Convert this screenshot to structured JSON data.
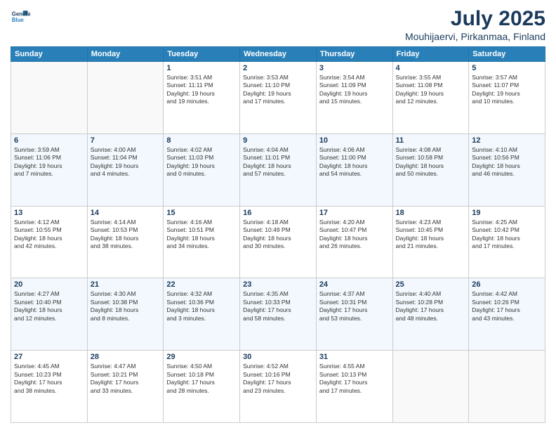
{
  "header": {
    "logo_line1": "General",
    "logo_line2": "Blue",
    "title": "July 2025",
    "subtitle": "Mouhijaervi, Pirkanmaa, Finland"
  },
  "weekdays": [
    "Sunday",
    "Monday",
    "Tuesday",
    "Wednesday",
    "Thursday",
    "Friday",
    "Saturday"
  ],
  "weeks": [
    [
      {
        "day": "",
        "info": ""
      },
      {
        "day": "",
        "info": ""
      },
      {
        "day": "1",
        "info": "Sunrise: 3:51 AM\nSunset: 11:11 PM\nDaylight: 19 hours\nand 19 minutes."
      },
      {
        "day": "2",
        "info": "Sunrise: 3:53 AM\nSunset: 11:10 PM\nDaylight: 19 hours\nand 17 minutes."
      },
      {
        "day": "3",
        "info": "Sunrise: 3:54 AM\nSunset: 11:09 PM\nDaylight: 19 hours\nand 15 minutes."
      },
      {
        "day": "4",
        "info": "Sunrise: 3:55 AM\nSunset: 11:08 PM\nDaylight: 19 hours\nand 12 minutes."
      },
      {
        "day": "5",
        "info": "Sunrise: 3:57 AM\nSunset: 11:07 PM\nDaylight: 19 hours\nand 10 minutes."
      }
    ],
    [
      {
        "day": "6",
        "info": "Sunrise: 3:59 AM\nSunset: 11:06 PM\nDaylight: 19 hours\nand 7 minutes."
      },
      {
        "day": "7",
        "info": "Sunrise: 4:00 AM\nSunset: 11:04 PM\nDaylight: 19 hours\nand 4 minutes."
      },
      {
        "day": "8",
        "info": "Sunrise: 4:02 AM\nSunset: 11:03 PM\nDaylight: 19 hours\nand 0 minutes."
      },
      {
        "day": "9",
        "info": "Sunrise: 4:04 AM\nSunset: 11:01 PM\nDaylight: 18 hours\nand 57 minutes."
      },
      {
        "day": "10",
        "info": "Sunrise: 4:06 AM\nSunset: 11:00 PM\nDaylight: 18 hours\nand 54 minutes."
      },
      {
        "day": "11",
        "info": "Sunrise: 4:08 AM\nSunset: 10:58 PM\nDaylight: 18 hours\nand 50 minutes."
      },
      {
        "day": "12",
        "info": "Sunrise: 4:10 AM\nSunset: 10:56 PM\nDaylight: 18 hours\nand 46 minutes."
      }
    ],
    [
      {
        "day": "13",
        "info": "Sunrise: 4:12 AM\nSunset: 10:55 PM\nDaylight: 18 hours\nand 42 minutes."
      },
      {
        "day": "14",
        "info": "Sunrise: 4:14 AM\nSunset: 10:53 PM\nDaylight: 18 hours\nand 38 minutes."
      },
      {
        "day": "15",
        "info": "Sunrise: 4:16 AM\nSunset: 10:51 PM\nDaylight: 18 hours\nand 34 minutes."
      },
      {
        "day": "16",
        "info": "Sunrise: 4:18 AM\nSunset: 10:49 PM\nDaylight: 18 hours\nand 30 minutes."
      },
      {
        "day": "17",
        "info": "Sunrise: 4:20 AM\nSunset: 10:47 PM\nDaylight: 18 hours\nand 26 minutes."
      },
      {
        "day": "18",
        "info": "Sunrise: 4:23 AM\nSunset: 10:45 PM\nDaylight: 18 hours\nand 21 minutes."
      },
      {
        "day": "19",
        "info": "Sunrise: 4:25 AM\nSunset: 10:42 PM\nDaylight: 18 hours\nand 17 minutes."
      }
    ],
    [
      {
        "day": "20",
        "info": "Sunrise: 4:27 AM\nSunset: 10:40 PM\nDaylight: 18 hours\nand 12 minutes."
      },
      {
        "day": "21",
        "info": "Sunrise: 4:30 AM\nSunset: 10:38 PM\nDaylight: 18 hours\nand 8 minutes."
      },
      {
        "day": "22",
        "info": "Sunrise: 4:32 AM\nSunset: 10:36 PM\nDaylight: 18 hours\nand 3 minutes."
      },
      {
        "day": "23",
        "info": "Sunrise: 4:35 AM\nSunset: 10:33 PM\nDaylight: 17 hours\nand 58 minutes."
      },
      {
        "day": "24",
        "info": "Sunrise: 4:37 AM\nSunset: 10:31 PM\nDaylight: 17 hours\nand 53 minutes."
      },
      {
        "day": "25",
        "info": "Sunrise: 4:40 AM\nSunset: 10:28 PM\nDaylight: 17 hours\nand 48 minutes."
      },
      {
        "day": "26",
        "info": "Sunrise: 4:42 AM\nSunset: 10:26 PM\nDaylight: 17 hours\nand 43 minutes."
      }
    ],
    [
      {
        "day": "27",
        "info": "Sunrise: 4:45 AM\nSunset: 10:23 PM\nDaylight: 17 hours\nand 38 minutes."
      },
      {
        "day": "28",
        "info": "Sunrise: 4:47 AM\nSunset: 10:21 PM\nDaylight: 17 hours\nand 33 minutes."
      },
      {
        "day": "29",
        "info": "Sunrise: 4:50 AM\nSunset: 10:18 PM\nDaylight: 17 hours\nand 28 minutes."
      },
      {
        "day": "30",
        "info": "Sunrise: 4:52 AM\nSunset: 10:16 PM\nDaylight: 17 hours\nand 23 minutes."
      },
      {
        "day": "31",
        "info": "Sunrise: 4:55 AM\nSunset: 10:13 PM\nDaylight: 17 hours\nand 17 minutes."
      },
      {
        "day": "",
        "info": ""
      },
      {
        "day": "",
        "info": ""
      }
    ]
  ]
}
